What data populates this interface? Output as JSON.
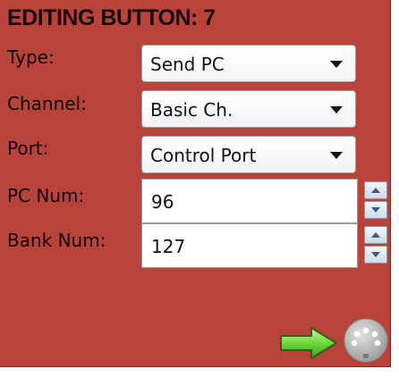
{
  "panel": {
    "title": "EDITING BUTTON: 7",
    "background_color": "#b8433a"
  },
  "fields": {
    "type": {
      "label": "Type:",
      "value": "Send PC"
    },
    "channel": {
      "label": "Channel:",
      "value": "Basic Ch."
    },
    "port": {
      "label": "Port:",
      "value": "Control Port"
    },
    "pc_num": {
      "label": "PC Num:",
      "value": "96"
    },
    "bank_num": {
      "label": "Bank Num:",
      "value": "127"
    }
  },
  "icons": {
    "send_arrow": "arrow-right-icon",
    "midi_connector": "midi-port-icon"
  }
}
